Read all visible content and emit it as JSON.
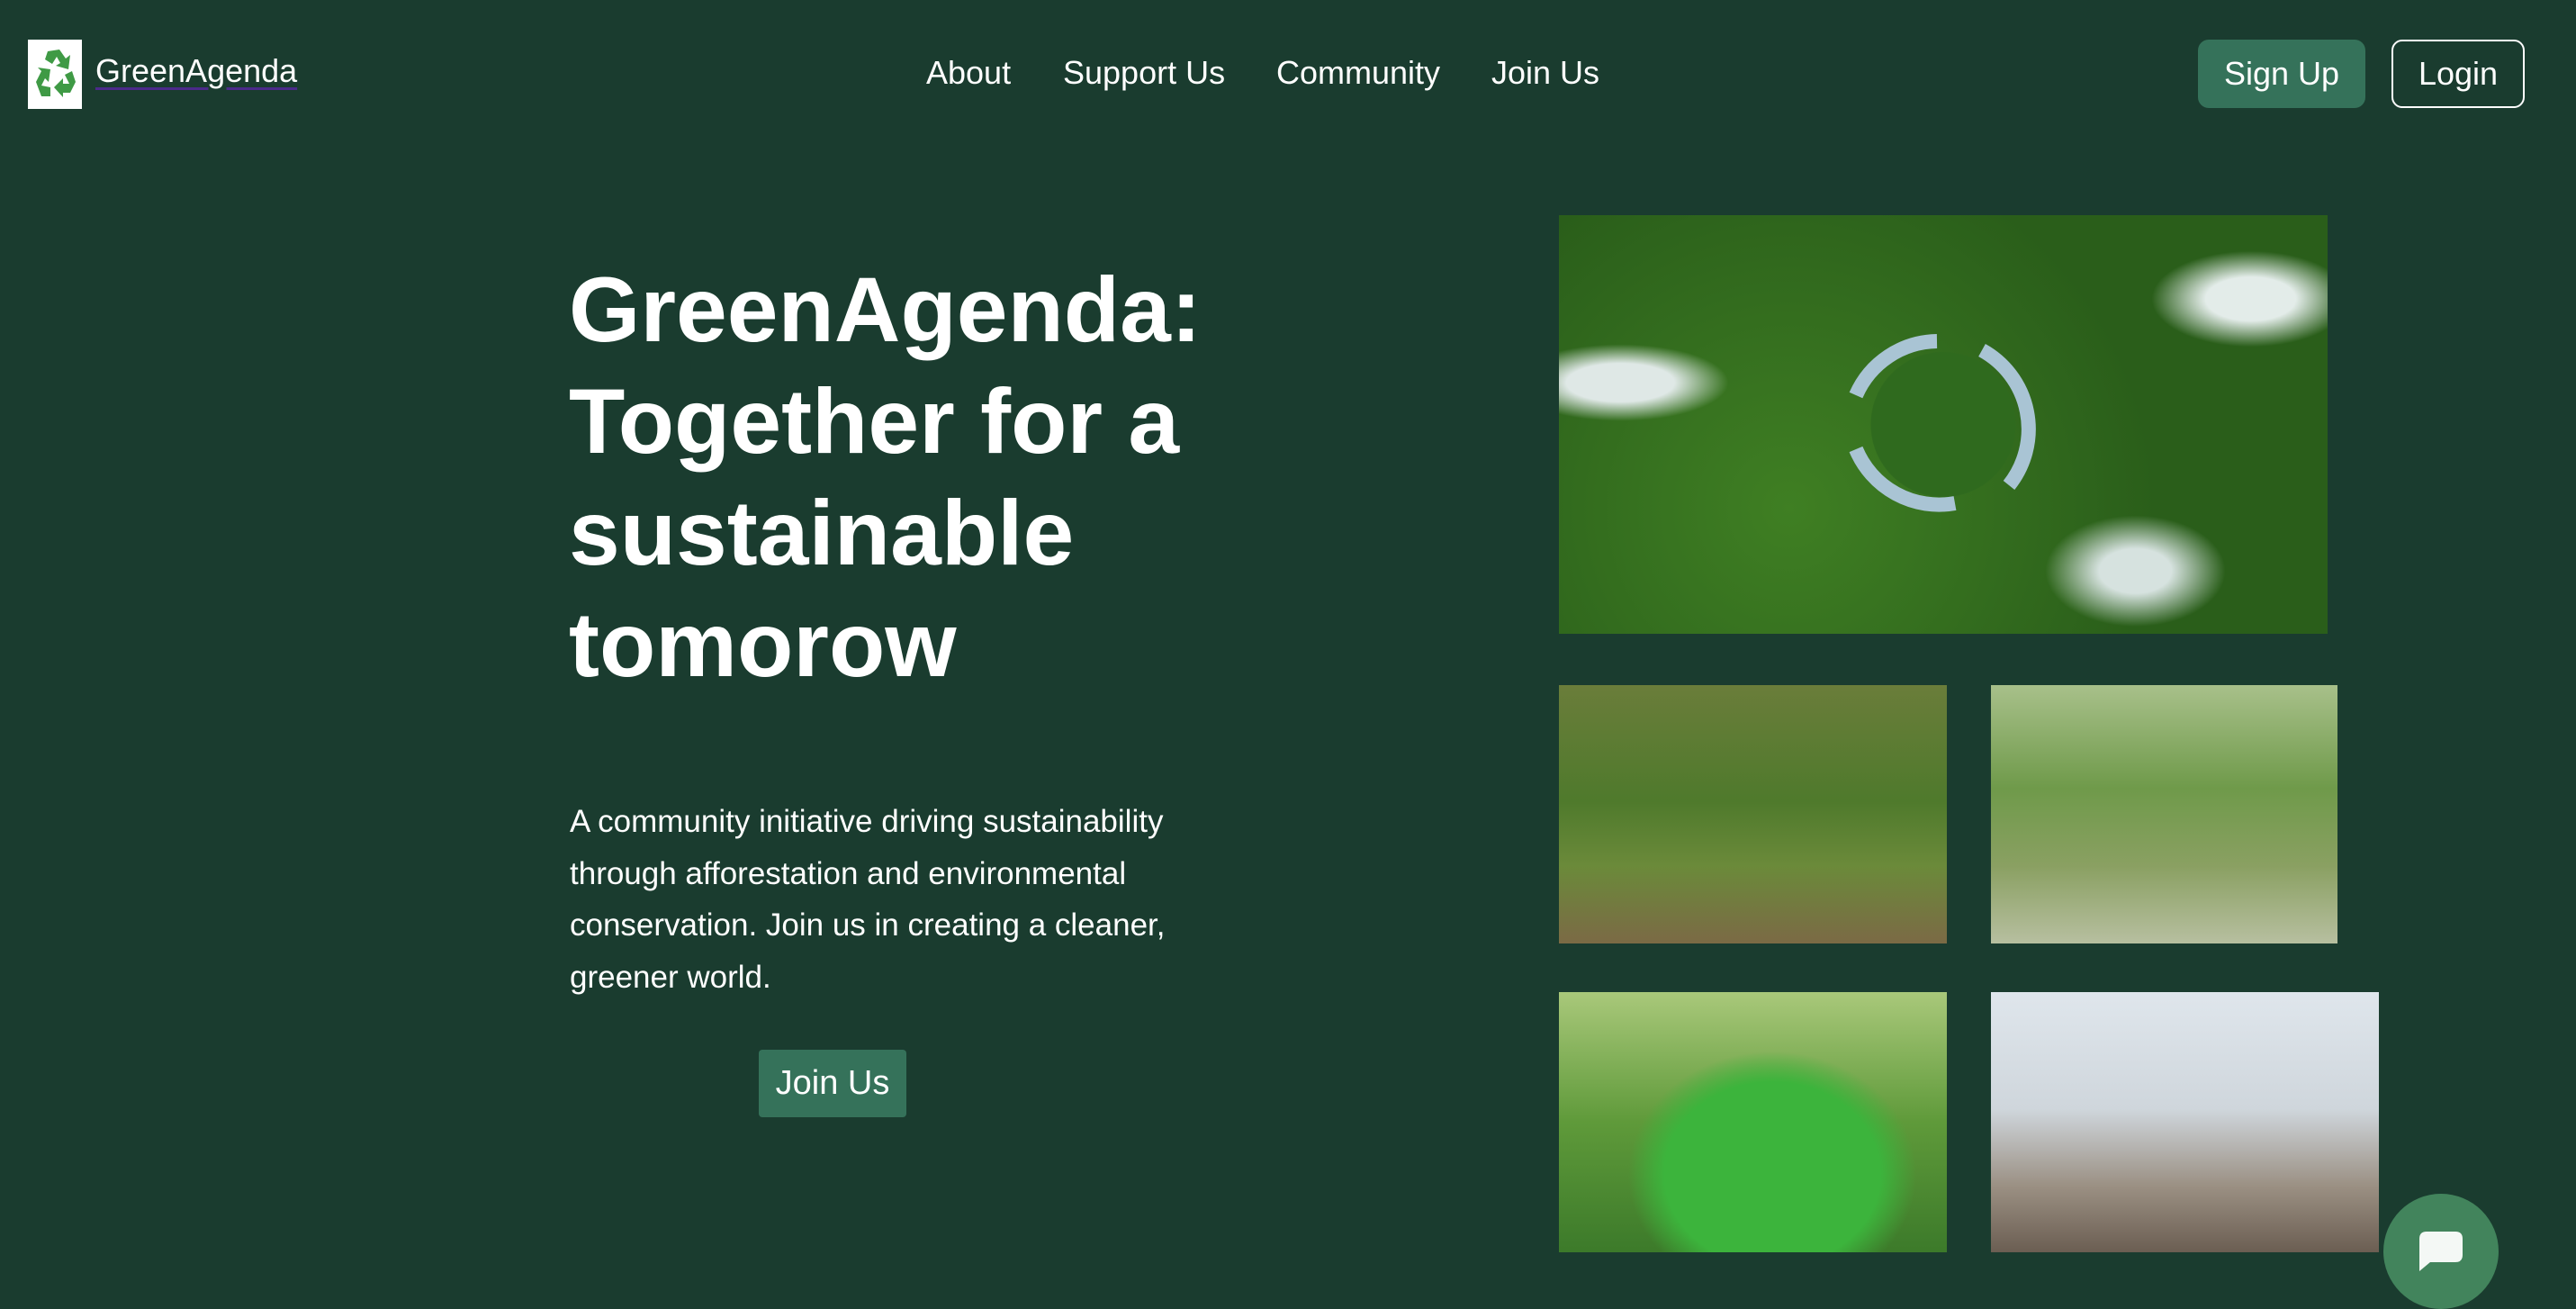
{
  "header": {
    "brand": "GreenAgenda",
    "logo_icon": "recycle-icon",
    "nav": [
      "About",
      "Support Us",
      "Community",
      "Join Us"
    ],
    "signup_label": "Sign Up",
    "login_label": "Login"
  },
  "hero": {
    "title": "GreenAgenda: Together for a sustainable tomorow",
    "description": "A community initiative driving sustainability through afforestation and environmental conservation. Join us in creating a cleaner, greener world.",
    "cta_label": "Join Us"
  },
  "gallery": [
    "forest-recycle-aerial",
    "volunteers-planting-tree",
    "volunteers-cleanup-park",
    "volunteers-recycling-bin",
    "volunteers-beach-cleanup"
  ],
  "chat": {
    "icon": "chat-bubble-icon"
  },
  "colors": {
    "background": "#1a3c2f",
    "accent": "#35725a",
    "chat": "#42845c"
  }
}
